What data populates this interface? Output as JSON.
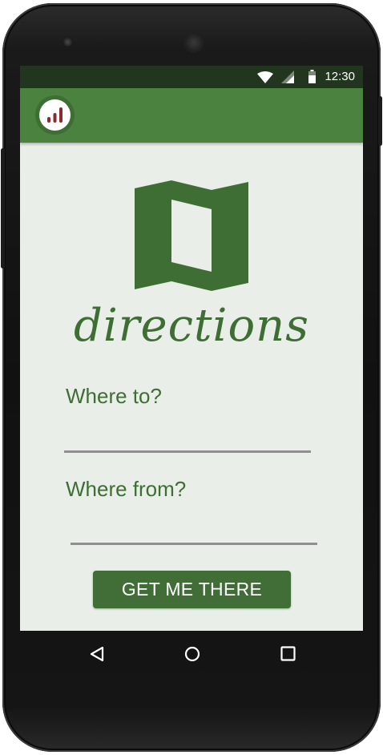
{
  "status_bar": {
    "time": "12:30",
    "icons": [
      "wifi-icon",
      "cell-signal-icon",
      "battery-icon"
    ]
  },
  "app_bar": {
    "logo_icon": "bar-chart-logo-icon"
  },
  "main": {
    "illustration_icon": "folded-map-icon",
    "title": "directions",
    "destination": {
      "label": "Where to?",
      "value": "",
      "placeholder": ""
    },
    "origin": {
      "label": "Where from?",
      "value": "",
      "placeholder": ""
    },
    "submit_label": "GET ME THERE"
  },
  "nav_bar": {
    "icons": [
      "back-icon",
      "home-icon",
      "recents-icon"
    ]
  },
  "colors": {
    "status_bar": "#22361f",
    "app_bar": "#4b823f",
    "accent": "#3f6e35",
    "button": "#416d37",
    "background": "#e9eee8",
    "logo_bars": "#8a2a30"
  }
}
